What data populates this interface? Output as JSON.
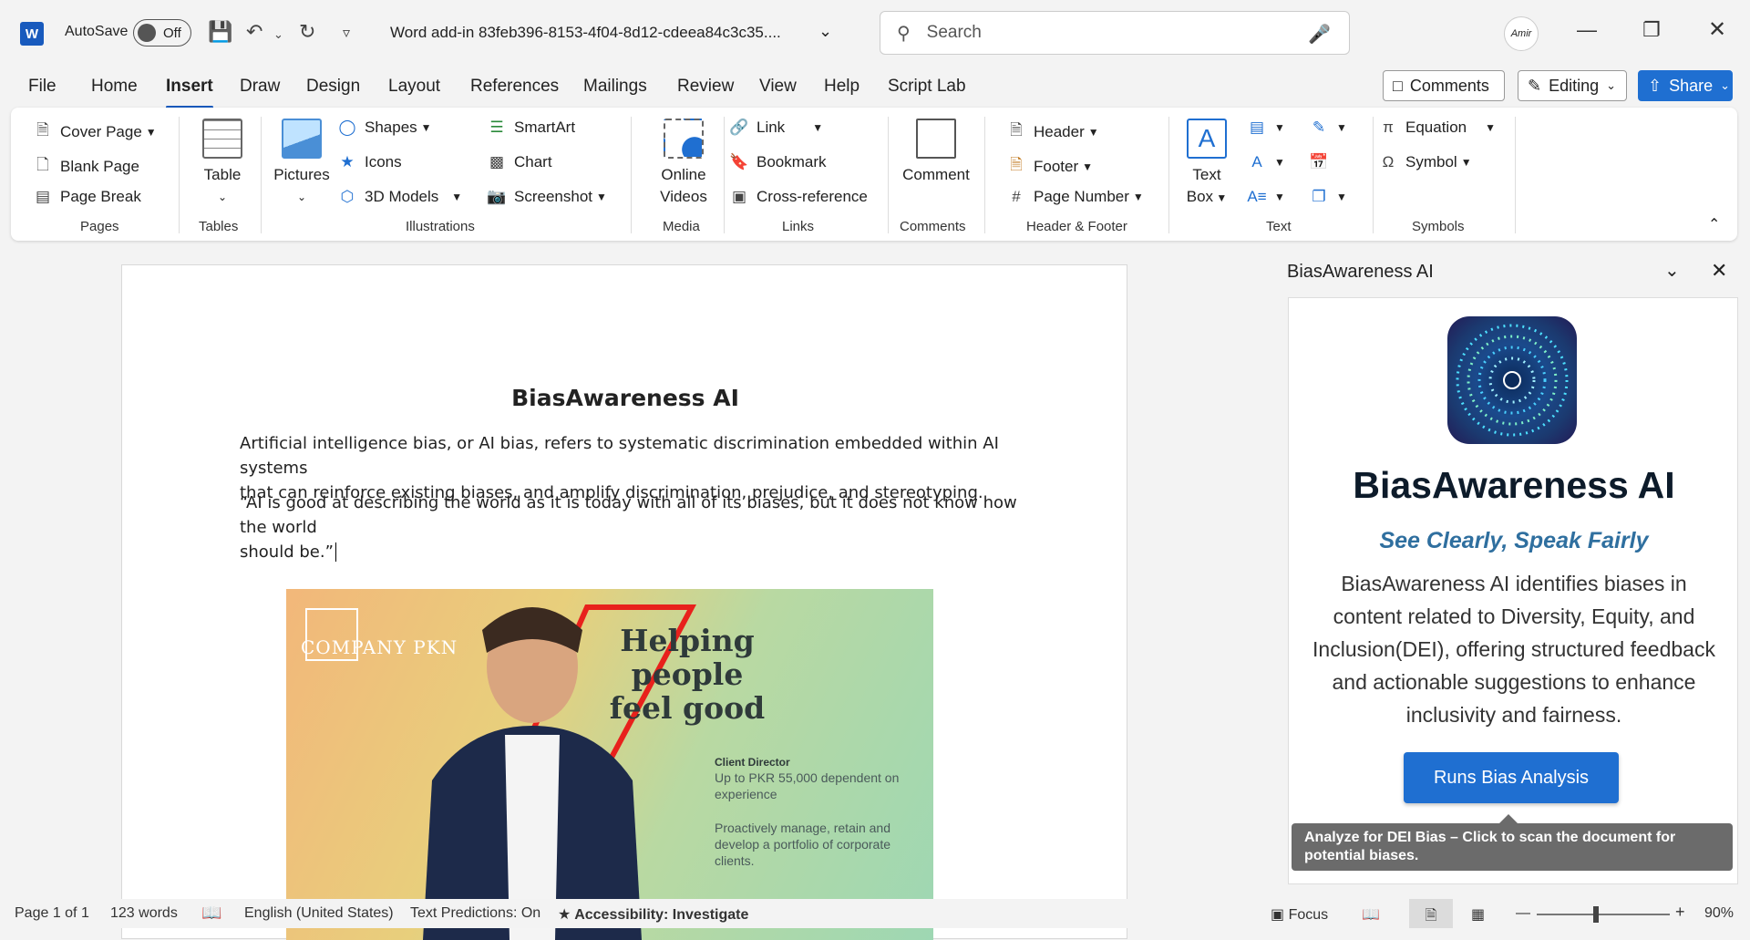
{
  "titlebar": {
    "autosave_label": "AutoSave",
    "autosave_state": "Off",
    "document_title": "Word add-in 83feb396-8153-4f04-8d12-cdeea84c3c35....",
    "search_placeholder": "Search",
    "user_avatar_text": "Amir"
  },
  "menu_tabs": [
    "File",
    "Home",
    "Insert",
    "Draw",
    "Design",
    "Layout",
    "References",
    "Mailings",
    "Review",
    "View",
    "Help",
    "Script Lab"
  ],
  "active_tab": "Insert",
  "right_buttons": {
    "comments": "Comments",
    "editing": "Editing",
    "share": "Share"
  },
  "ribbon": {
    "pages": {
      "cover_page": "Cover Page",
      "blank_page": "Blank Page",
      "page_break": "Page Break",
      "group": "Pages"
    },
    "tables": {
      "table": "Table",
      "group": "Tables"
    },
    "illustrations": {
      "pictures": "Pictures",
      "shapes": "Shapes",
      "icons": "Icons",
      "models": "3D Models",
      "smartart": "SmartArt",
      "chart": "Chart",
      "screenshot": "Screenshot",
      "group": "Illustrations"
    },
    "media": {
      "online": "Online",
      "videos": "Videos",
      "group": "Media"
    },
    "links": {
      "link": "Link",
      "bookmark": "Bookmark",
      "cross_reference": "Cross-reference",
      "group": "Links"
    },
    "comments": {
      "comment": "Comment",
      "group": "Comments"
    },
    "header_footer": {
      "header": "Header",
      "footer": "Footer",
      "page_number": "Page Number",
      "group": "Header & Footer"
    },
    "text": {
      "text": "Text",
      "box": "Box",
      "group": "Text"
    },
    "symbols": {
      "equation": "Equation",
      "symbol": "Symbol",
      "group": "Symbols"
    }
  },
  "document": {
    "title": "BiasAwareness AI",
    "para1_line1": "Artificial intelligence bias, or AI bias, refers to systematic discrimination embedded within AI systems",
    "para1_line2": "that can reinforce existing biases, and amplify discrimination, prejudice, and stereotyping.",
    "para2_line1": "“AI is good at describing the world as it is today with all of its biases, but it does not know how the world",
    "para2_line2": "should be.”",
    "poster": {
      "company": "COMPANY PKN",
      "headline": [
        "Helping",
        "people",
        "feel good"
      ],
      "role": "Client Director",
      "salary": "Up to PKR 55,000 dependent on experience",
      "desc": "Proactively manage, retain and develop a portfolio of corporate clients."
    }
  },
  "pane": {
    "header": "BiasAwareness AI",
    "title": "BiasAwareness AI",
    "tagline": "See Clearly, Speak Fairly",
    "description": "BiasAwareness AI identifies biases in content related to Diversity, Equity, and Inclusion(DEI), offering structured feedback and actionable suggestions to enhance inclusivity and fairness.",
    "button": "Runs Bias Analysis",
    "tooltip": "Analyze for DEI Bias – Click to scan the document for potential biases."
  },
  "statusbar": {
    "page": "Page 1 of 1",
    "words": "123 words",
    "language": "English (United States)",
    "predictions": "Text Predictions: On",
    "accessibility": "Accessibility: Investigate",
    "focus": "Focus",
    "zoom": "90%"
  },
  "colors": {
    "accent": "#185abd",
    "button": "#1f6fd1"
  }
}
